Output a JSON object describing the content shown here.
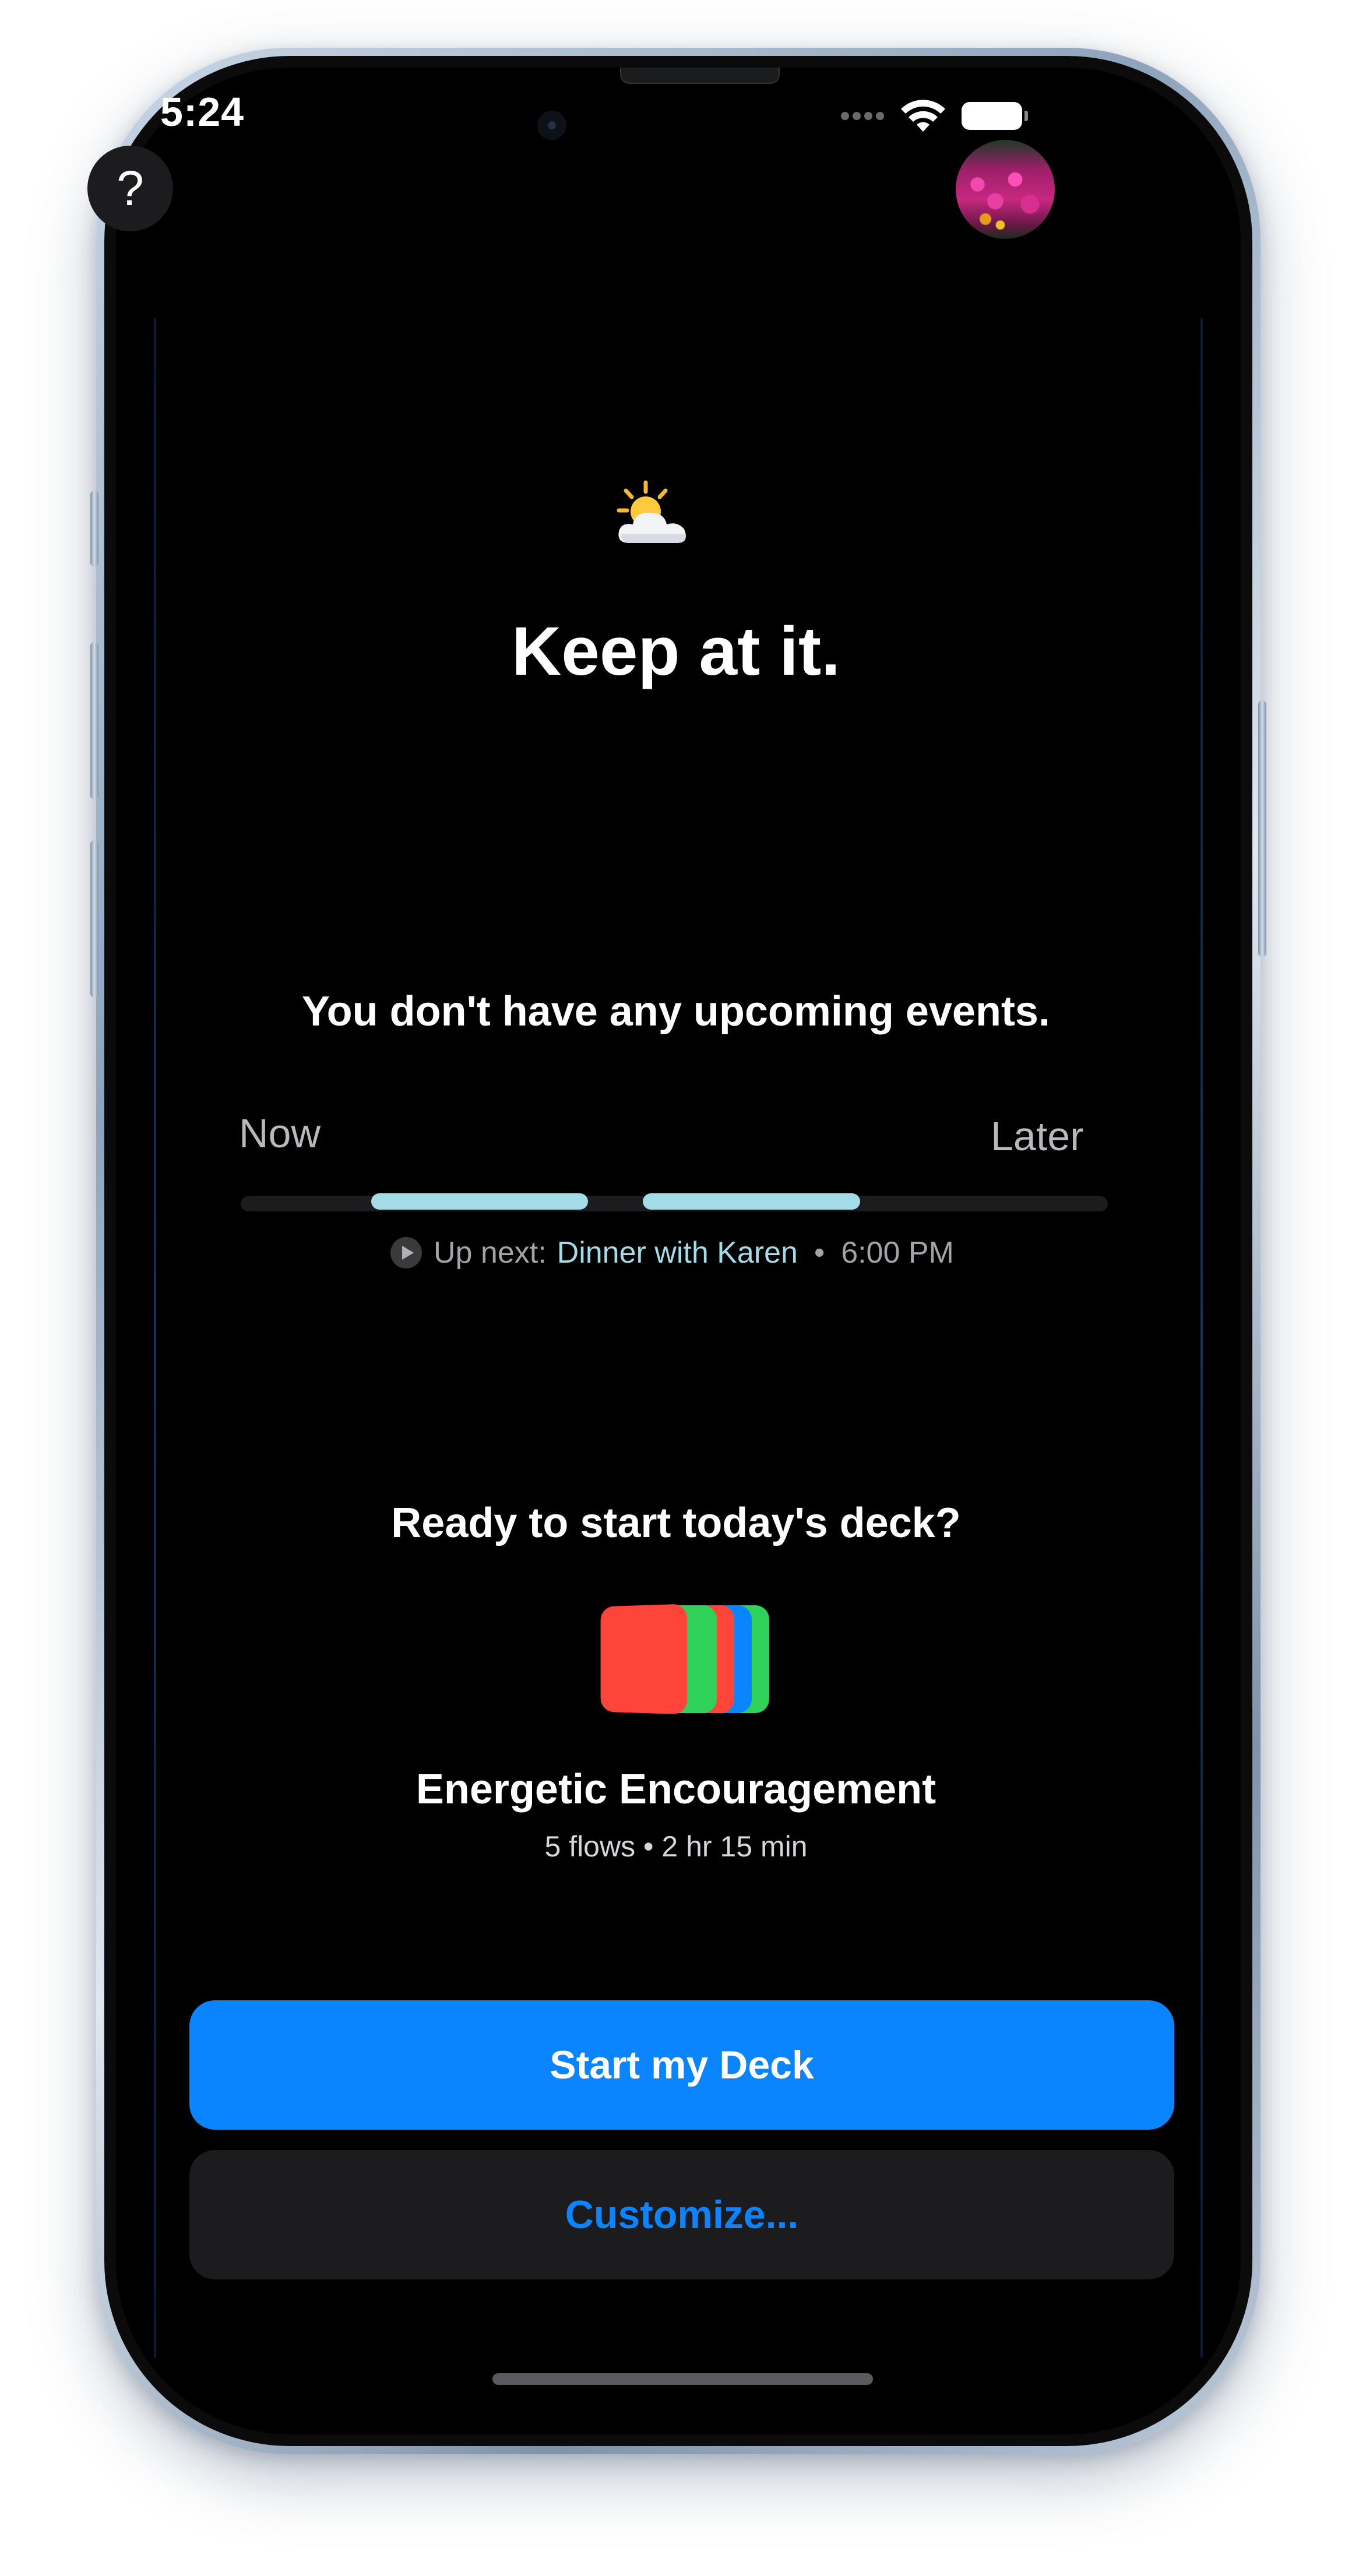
{
  "status_bar": {
    "time": "5:24"
  },
  "header": {
    "help_label": "?",
    "weather_icon": "sun-behind-cloud-icon"
  },
  "main": {
    "headline": "Keep at it.",
    "events_message": "You don't have any upcoming events.",
    "timeline": {
      "start_label": "Now",
      "end_label": "Later",
      "up_next_prefix": "Up next:",
      "up_next_event": "Dinner with Karen",
      "separator": "•",
      "up_next_time": "6:00 PM",
      "accent_color": "#a3dce6"
    },
    "deck": {
      "question": "Ready to start today's deck?",
      "name": "Energetic Encouragement",
      "meta": "5 flows • 2 hr 15 min",
      "card_colors": [
        "#ff453a",
        "#30d158",
        "#0a84ff",
        "#ff453a",
        "#30d158"
      ]
    }
  },
  "actions": {
    "start_label": "Start my Deck",
    "customize_label": "Customize...",
    "primary_color": "#0a84ff"
  }
}
